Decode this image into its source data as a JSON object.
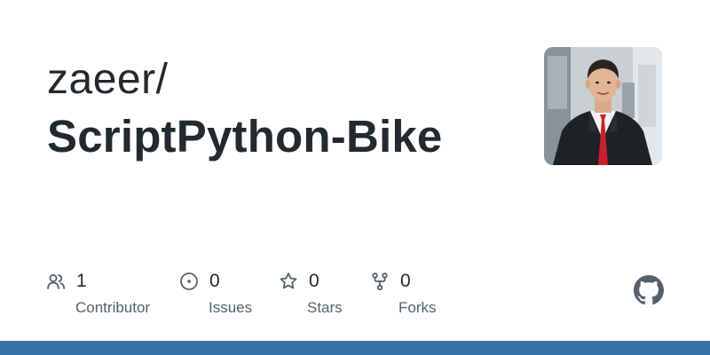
{
  "repo": {
    "owner": "zaeer/",
    "name": "ScriptPython-Bike"
  },
  "stats": [
    {
      "value": "1",
      "label": "Contributor",
      "icon": "people-icon"
    },
    {
      "value": "0",
      "label": "Issues",
      "icon": "issue-circle-icon"
    },
    {
      "value": "0",
      "label": "Stars",
      "icon": "star-icon"
    },
    {
      "value": "0",
      "label": "Forks",
      "icon": "fork-icon"
    }
  ],
  "colors": {
    "text_primary": "#24292f",
    "text_secondary": "#57606a",
    "icon": "#57606a",
    "bottom_bar": "#3572a5",
    "logo": "#57606a"
  },
  "icons": {
    "avatar": "owner-avatar",
    "logo": "github-logo-icon"
  }
}
